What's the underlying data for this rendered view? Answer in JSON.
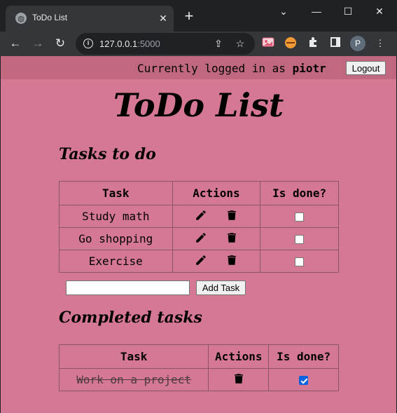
{
  "browser": {
    "tab_title": "ToDo List",
    "url_host": "127.0.0.1",
    "url_port": ":5000",
    "profile_initial": "P"
  },
  "header": {
    "login_prefix": "Currently logged in as",
    "username": "piotr",
    "logout_label": "Logout"
  },
  "app_title": "ToDo List",
  "todo": {
    "section_title": "Tasks to do",
    "columns": [
      "Task",
      "Actions",
      "Is done?"
    ],
    "rows": [
      {
        "task": "Study math",
        "done": false
      },
      {
        "task": "Go shopping",
        "done": false
      },
      {
        "task": "Exercise",
        "done": false
      }
    ],
    "input_value": "",
    "add_label": "Add Task"
  },
  "completed": {
    "section_title": "Completed tasks",
    "columns": [
      "Task",
      "Actions",
      "Is done?"
    ],
    "rows": [
      {
        "task": "Work on a project",
        "done": true
      }
    ]
  },
  "icons": {
    "edit": "pencil-icon",
    "delete": "trash-icon"
  }
}
